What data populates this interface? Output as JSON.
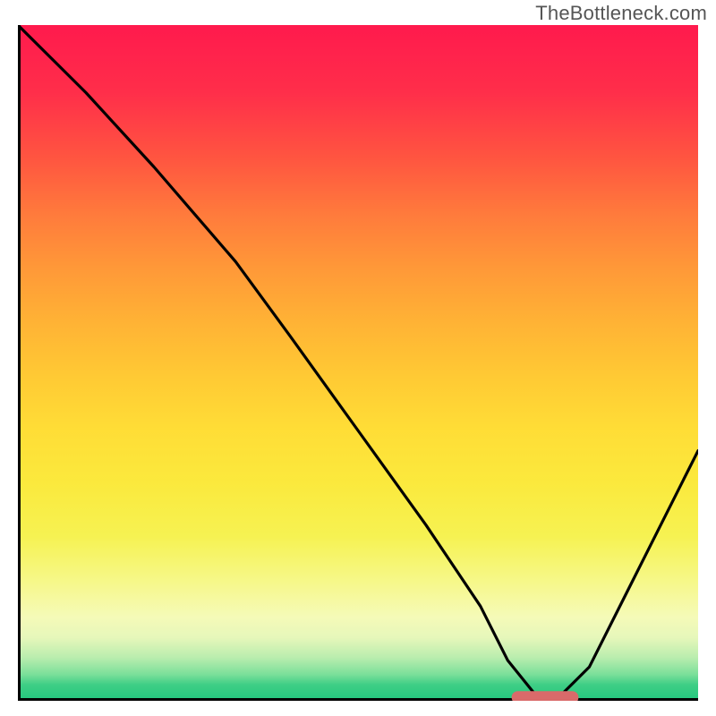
{
  "watermark": "TheBottleneck.com",
  "chart_data": {
    "type": "line",
    "title": "",
    "xlabel": "",
    "ylabel": "",
    "xlim": [
      0,
      1
    ],
    "ylim": [
      0,
      1
    ],
    "grid": false,
    "background_gradient": {
      "top": "#ff1a4d",
      "mid_upper": "#ffb235",
      "mid_lower": "#f6f252",
      "bottom": "#27c87f"
    },
    "series": [
      {
        "name": "bottleneck-curve",
        "x": [
          0.0,
          0.1,
          0.2,
          0.26,
          0.32,
          0.4,
          0.5,
          0.6,
          0.68,
          0.72,
          0.76,
          0.8,
          0.84,
          0.9,
          1.0
        ],
        "y": [
          1.0,
          0.9,
          0.79,
          0.72,
          0.65,
          0.54,
          0.4,
          0.26,
          0.14,
          0.06,
          0.01,
          0.01,
          0.05,
          0.17,
          0.37
        ],
        "color": "#000000"
      }
    ],
    "marker": {
      "name": "optimal-range",
      "color": "#d96a6a",
      "x_start": 0.735,
      "x_end": 0.815,
      "y": 0.005,
      "thickness_px": 14
    }
  }
}
